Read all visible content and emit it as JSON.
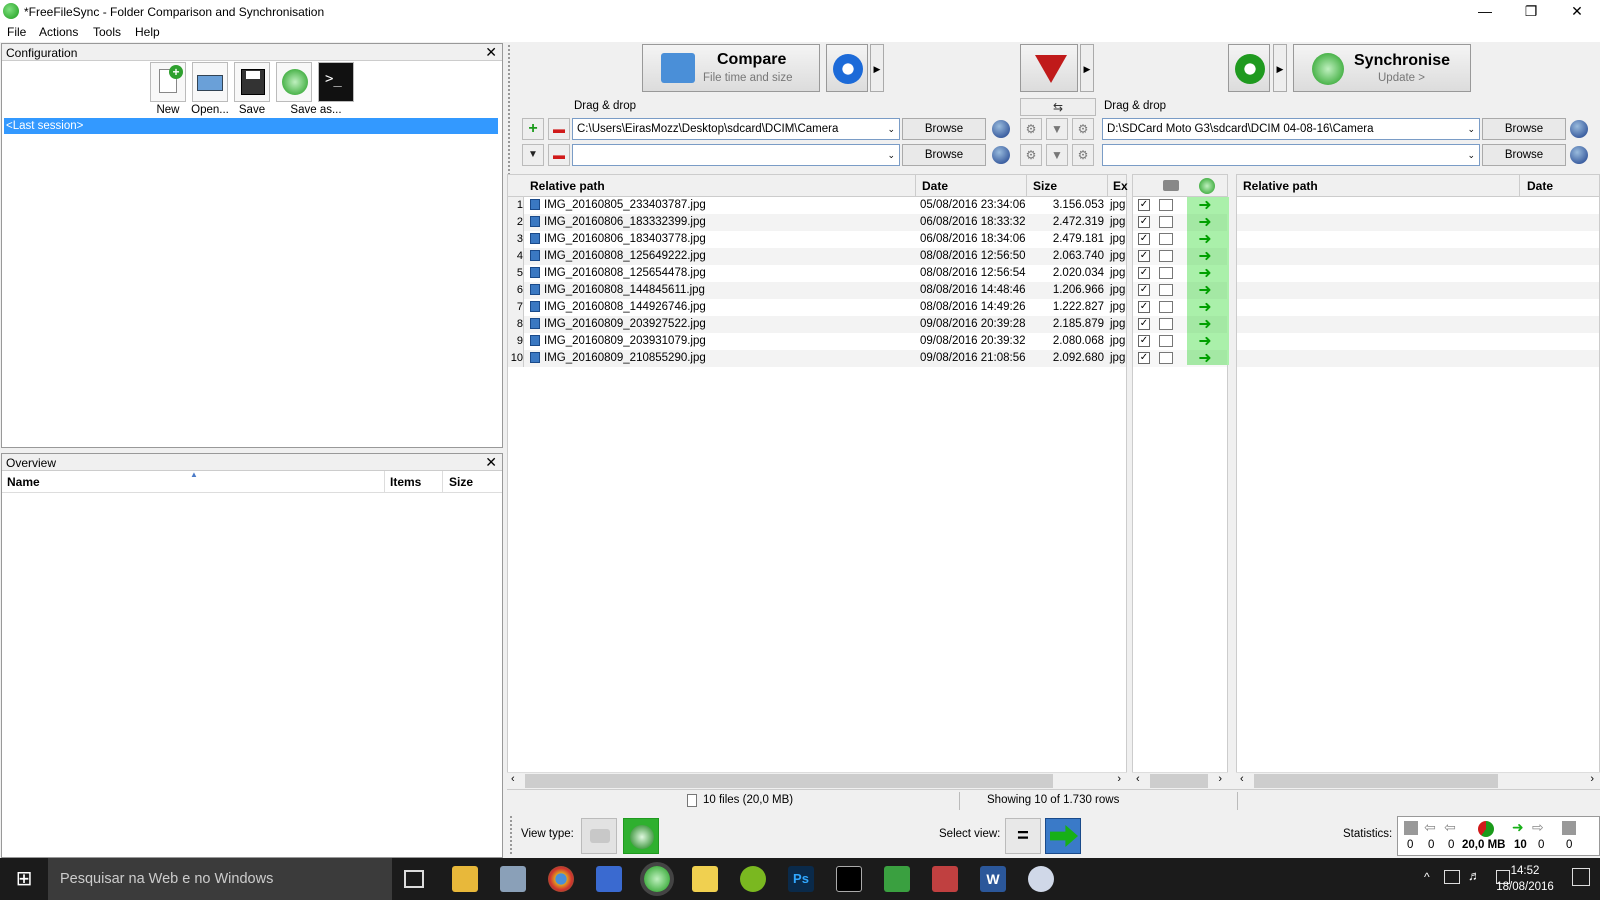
{
  "window": {
    "title": "*FreeFileSync - Folder Comparison and Synchronisation"
  },
  "menu": [
    "File",
    "Actions",
    "Tools",
    "Help"
  ],
  "config_panel": {
    "title": "Configuration",
    "buttons": [
      "New",
      "Open...",
      "Save",
      "Save as..."
    ],
    "session": "<Last session>"
  },
  "overview_panel": {
    "title": "Overview",
    "columns": [
      "Name",
      "Items",
      "Size"
    ]
  },
  "toolbar": {
    "compare_label": "Compare",
    "compare_sub": "File time and size",
    "sync_label": "Synchronise",
    "sync_sub": "Update >"
  },
  "left_folder": {
    "drag_label": "Drag & drop",
    "path": "C:\\Users\\EirasMozz\\Desktop\\sdcard\\DCIM\\Camera",
    "path2": "",
    "browse": "Browse"
  },
  "right_folder": {
    "drag_label": "Drag & drop",
    "path": "D:\\SDCard Moto G3\\sdcard\\DCIM 04-08-16\\Camera",
    "path2": "",
    "browse": "Browse"
  },
  "left_grid": {
    "columns": [
      "Relative path",
      "Date",
      "Size",
      "Ex"
    ],
    "rows": [
      {
        "n": "1",
        "name": "IMG_20160805_233403787.jpg",
        "date": "05/08/2016  23:34:06",
        "size": "3.156.053",
        "ext": "jpg"
      },
      {
        "n": "2",
        "name": "IMG_20160806_183332399.jpg",
        "date": "06/08/2016  18:33:32",
        "size": "2.472.319",
        "ext": "jpg"
      },
      {
        "n": "3",
        "name": "IMG_20160806_183403778.jpg",
        "date": "06/08/2016  18:34:06",
        "size": "2.479.181",
        "ext": "jpg"
      },
      {
        "n": "4",
        "name": "IMG_20160808_125649222.jpg",
        "date": "08/08/2016  12:56:50",
        "size": "2.063.740",
        "ext": "jpg"
      },
      {
        "n": "5",
        "name": "IMG_20160808_125654478.jpg",
        "date": "08/08/2016  12:56:54",
        "size": "2.020.034",
        "ext": "jpg"
      },
      {
        "n": "6",
        "name": "IMG_20160808_144845611.jpg",
        "date": "08/08/2016  14:48:46",
        "size": "1.206.966",
        "ext": "jpg"
      },
      {
        "n": "7",
        "name": "IMG_20160808_144926746.jpg",
        "date": "08/08/2016  14:49:26",
        "size": "1.222.827",
        "ext": "jpg"
      },
      {
        "n": "8",
        "name": "IMG_20160809_203927522.jpg",
        "date": "09/08/2016  20:39:28",
        "size": "2.185.879",
        "ext": "jpg"
      },
      {
        "n": "9",
        "name": "IMG_20160809_203931079.jpg",
        "date": "09/08/2016  20:39:32",
        "size": "2.080.068",
        "ext": "jpg"
      },
      {
        "n": "10",
        "name": "IMG_20160809_210855290.jpg",
        "date": "09/08/2016  21:08:56",
        "size": "2.092.680",
        "ext": "jpg"
      }
    ]
  },
  "right_grid": {
    "columns": [
      "Relative path",
      "Date"
    ]
  },
  "status": {
    "files": "10 files (20,0 MB)",
    "rows": "Showing 10 of 1.730 rows"
  },
  "bottom": {
    "view_type": "View type:",
    "select_view": "Select view:",
    "statistics": "Statistics:",
    "stats": [
      "0",
      "0",
      "0",
      "20,0 MB",
      "10",
      "0",
      "0"
    ]
  },
  "taskbar": {
    "search": "Pesquisar na Web e no Windows",
    "time": "14:52",
    "date": "18/08/2016"
  }
}
